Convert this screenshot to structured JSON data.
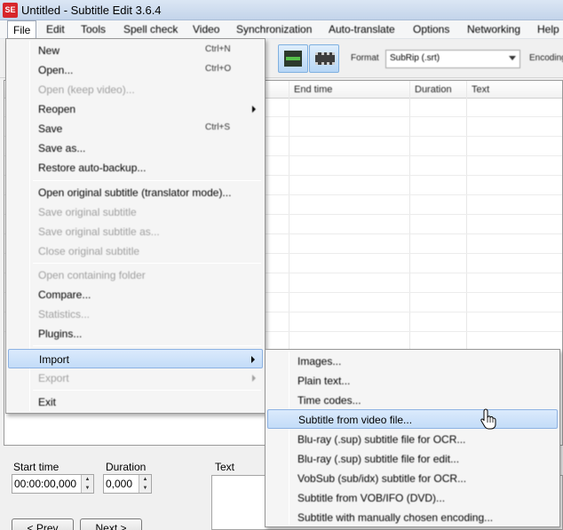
{
  "window": {
    "title": "Untitled - Subtitle Edit 3.6.4",
    "app_icon_text": "SE"
  },
  "menubar": {
    "items": [
      {
        "label": "File"
      },
      {
        "label": "Edit"
      },
      {
        "label": "Tools"
      },
      {
        "label": "Spell check"
      },
      {
        "label": "Video"
      },
      {
        "label": "Synchronization"
      },
      {
        "label": "Auto-translate"
      },
      {
        "label": "Options"
      },
      {
        "label": "Networking"
      },
      {
        "label": "Help"
      }
    ]
  },
  "toolbar": {
    "format_label": "Format",
    "format_value": "SubRip (.srt)",
    "encoding_label": "Encoding"
  },
  "grid": {
    "columns": [
      "End time",
      "Duration",
      "Text"
    ]
  },
  "edit_panel": {
    "start_time_label": "Start time",
    "start_time_value": "00:00:00,000",
    "duration_label": "Duration",
    "duration_value": "0,000",
    "text_label": "Text",
    "prev_button": "< Prev",
    "next_button": "Next >"
  },
  "file_menu": {
    "new": {
      "label": "New",
      "shortcut": "Ctrl+N"
    },
    "open": {
      "label": "Open...",
      "shortcut": "Ctrl+O"
    },
    "open_keep_video": {
      "label": "Open (keep video)..."
    },
    "reopen": {
      "label": "Reopen"
    },
    "save": {
      "label": "Save",
      "shortcut": "Ctrl+S"
    },
    "save_as": {
      "label": "Save as..."
    },
    "restore_backup": {
      "label": "Restore auto-backup..."
    },
    "open_original": {
      "label": "Open original subtitle (translator mode)..."
    },
    "save_original": {
      "label": "Save original subtitle"
    },
    "save_original_as": {
      "label": "Save original subtitle as..."
    },
    "close_original": {
      "label": "Close original subtitle"
    },
    "open_folder": {
      "label": "Open containing folder"
    },
    "compare": {
      "label": "Compare..."
    },
    "statistics": {
      "label": "Statistics..."
    },
    "plugins": {
      "label": "Plugins..."
    },
    "import": {
      "label": "Import"
    },
    "export": {
      "label": "Export"
    },
    "exit": {
      "label": "Exit"
    }
  },
  "import_submenu": {
    "items": [
      {
        "label": "Images..."
      },
      {
        "label": "Plain text..."
      },
      {
        "label": "Time codes..."
      },
      {
        "label": "Subtitle from video file..."
      },
      {
        "label": "Blu-ray (.sup) subtitle file for OCR..."
      },
      {
        "label": "Blu-ray (.sup) subtitle file for edit..."
      },
      {
        "label": "VobSub (sub/idx) subtitle for OCR..."
      },
      {
        "label": "Subtitle from VOB/IFO (DVD)..."
      },
      {
        "label": "Subtitle with manually chosen encoding..."
      }
    ]
  }
}
